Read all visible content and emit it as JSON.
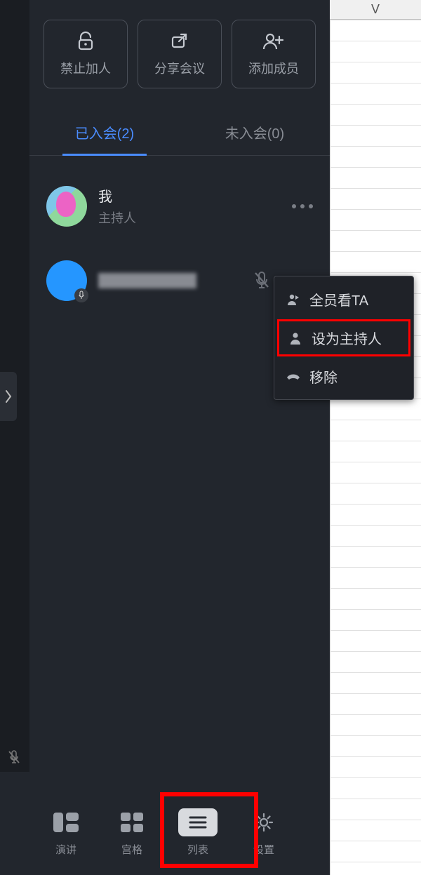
{
  "background": {
    "column_header": "V"
  },
  "top_actions": {
    "lock": "禁止加人",
    "share": "分享会议",
    "add": "添加成员"
  },
  "tabs": {
    "joined": "已入会(2)",
    "not_joined": "未入会(0)"
  },
  "participants": [
    {
      "name": "我",
      "role": "主持人",
      "avatar": "patrick",
      "has_badge": false,
      "muted": false
    },
    {
      "name": "",
      "role": "",
      "avatar": "blue",
      "has_badge": true,
      "muted": true,
      "redacted": true
    }
  ],
  "context_menu": {
    "spotlight": "全员看TA",
    "make_host": "设为主持人",
    "remove": "移除"
  },
  "bottom_bar": {
    "speaker": "演讲",
    "grid": "宫格",
    "list": "列表",
    "settings": "设置"
  }
}
